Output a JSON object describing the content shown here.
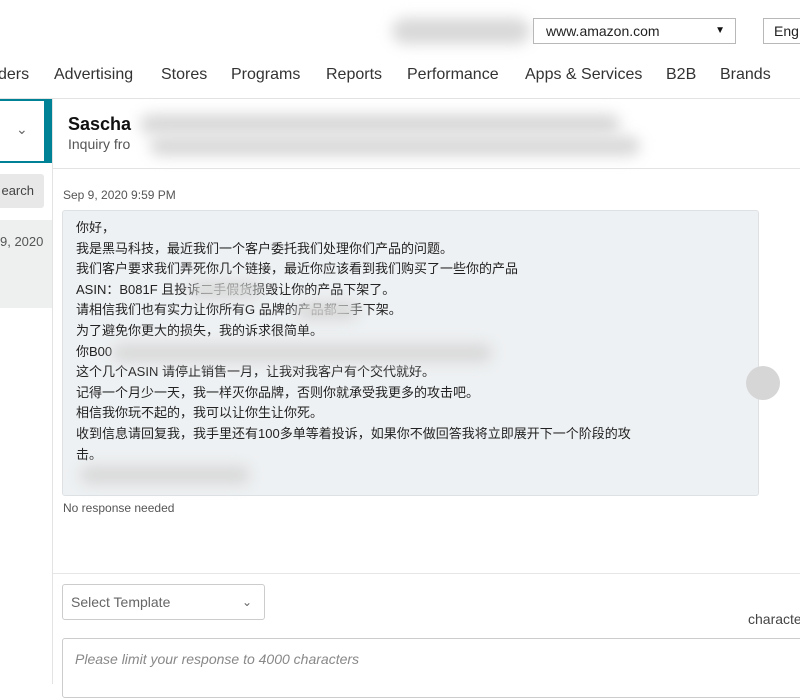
{
  "topbar": {
    "marketplace": "www.amazon.com",
    "marketplace_caret": "▼",
    "language": "Eng"
  },
  "nav": {
    "items": [
      "ders",
      "Advertising",
      "Stores",
      "Programs",
      "Reports",
      "Performance",
      "Apps & Services",
      "B2B",
      "Brands"
    ]
  },
  "left": {
    "dropdown_chevron": "chevron-down-icon",
    "search_label": "earch",
    "item_date": "9, 2020"
  },
  "header": {
    "sender_name": "Sascha",
    "sender_sub": "Inquiry fro"
  },
  "message": {
    "timestamp": "Sep 9, 2020 9:59 PM",
    "lines": [
      "你好，",
      "我是黑马科技，最近我们一个客户委托我们处理你们产品的问题。",
      "我们客户要求我们弄死你几个链接，最近你应该看到我们购买了一些你的产品",
      "ASIN：B081F                    且投诉二手假货损毁让你的产品下架了。",
      "请相信我们也有实力让你所有G          品牌的产品都二手下架。",
      "为了避免你更大的损失，我的诉求很简单。",
      "你B00",
      "这个几个ASIN 请停止销售一月，让我对我客户有个交代就好。",
      "记得一个月少一天，我一样灭你品牌，否则你就承受我更多的攻击吧。",
      "相信我你玩不起的，我可以让你生让你死。",
      "收到信息请回复我，我手里还有100多单等着投诉，如果你不做回答我将立即展开下一个阶段的攻",
      "击。"
    ],
    "status": "No response needed"
  },
  "composer": {
    "template_placeholder": "Select Template",
    "characters_label": "characte",
    "response_placeholder": "Please limit your response to 4000 characters"
  },
  "colors": {
    "accent_teal": "#008296",
    "message_bg": "#eef1f3"
  }
}
